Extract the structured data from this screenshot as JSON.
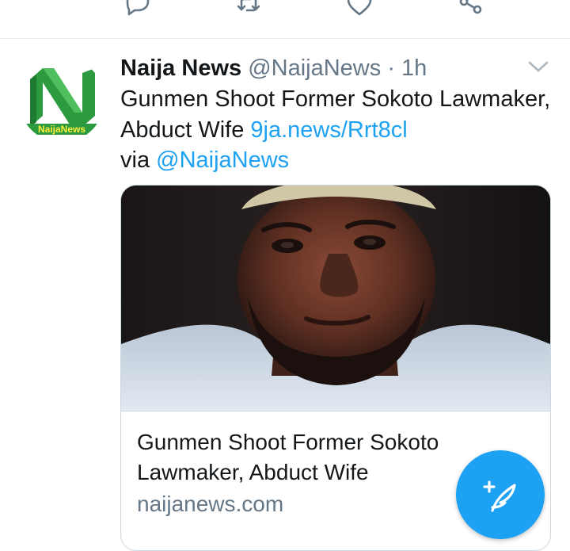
{
  "actions": {
    "icons": [
      "reply-icon",
      "retweet-icon",
      "like-icon",
      "share-icon"
    ]
  },
  "tweet": {
    "display_name": "Naija News",
    "handle": "@NaijaNews",
    "separator": "·",
    "timestamp": "1h",
    "text_main": "Gunmen Shoot Former Sokoto Lawmaker, Abduct Wife ",
    "link_short": "9ja.news/Rrt8cl",
    "via_prefix": "via ",
    "via_mention": "@NaijaNews",
    "avatar_logo_text": "NaijaNews"
  },
  "card": {
    "title": "Gunmen Shoot Former Sokoto Lawmaker, Abduct Wife",
    "domain": "naijanews.com"
  },
  "colors": {
    "accent": "#1da1f2",
    "text_primary": "#14171a",
    "text_secondary": "#657786",
    "divider": "#e6ecf0",
    "brand_green": "#2c9a3f"
  }
}
